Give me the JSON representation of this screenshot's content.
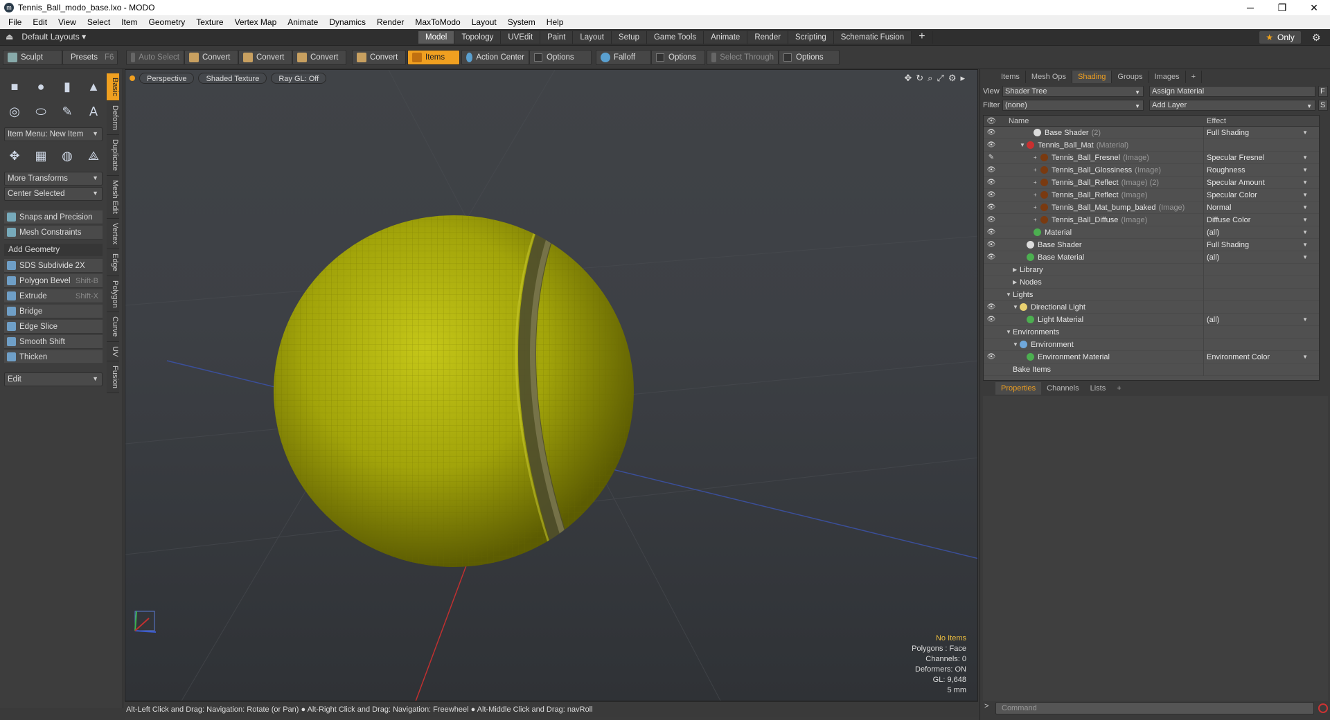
{
  "window": {
    "title": "Tennis_Ball_modo_base.lxo - MODO",
    "minimize": "─",
    "maximize": "❐",
    "close": "✕"
  },
  "menu": [
    "File",
    "Edit",
    "View",
    "Select",
    "Item",
    "Geometry",
    "Texture",
    "Vertex Map",
    "Animate",
    "Dynamics",
    "Render",
    "MaxToModo",
    "Layout",
    "System",
    "Help"
  ],
  "layoutbar": {
    "layout_label": "Default Layouts ▾",
    "tabs": [
      "Model",
      "Topology",
      "UVEdit",
      "Paint",
      "Layout",
      "Setup",
      "Game Tools",
      "Animate",
      "Render",
      "Scripting",
      "Schematic Fusion"
    ],
    "active_tab": "Model",
    "plus": "+",
    "only_label": "Only",
    "star": "★"
  },
  "toolbar": {
    "sculpt": "Sculpt",
    "presets": "Presets",
    "presets_key": "F6",
    "auto_select": "Auto Select",
    "convert1": "Convert",
    "convert2": "Convert",
    "convert3": "Convert",
    "convert4": "Convert",
    "items": "Items",
    "action_center": "Action Center",
    "options1": "Options",
    "falloff": "Falloff",
    "options2": "Options",
    "select_through": "Select Through",
    "options3": "Options"
  },
  "leftpanel": {
    "item_menu": "Item Menu: New Item",
    "more_transforms": "More Transforms",
    "center_selected": "Center Selected",
    "snaps": "Snaps and Precision",
    "mesh_constraints": "Mesh Constraints",
    "add_geometry": "Add Geometry",
    "tools": [
      {
        "label": "SDS Subdivide 2X",
        "key": ""
      },
      {
        "label": "Polygon Bevel",
        "key": "Shift-B"
      },
      {
        "label": "Extrude",
        "key": "Shift-X"
      },
      {
        "label": "Bridge",
        "key": ""
      },
      {
        "label": "Edge Slice",
        "key": ""
      },
      {
        "label": "Smooth Shift",
        "key": ""
      },
      {
        "label": "Thicken",
        "key": ""
      }
    ],
    "edit": "Edit",
    "vtabs": [
      "Basic",
      "Deform",
      "Duplicate",
      "Mesh Edit",
      "Vertex",
      "Edge",
      "Polygon",
      "Curve",
      "UV",
      "Fusion"
    ]
  },
  "viewport": {
    "view_mode": "Perspective",
    "shading": "Shaded Texture",
    "raygl": "Ray GL: Off",
    "info": {
      "selection": "No Items",
      "polygons": "Polygons : Face",
      "channels": "Channels: 0",
      "deformers": "Deformers: ON",
      "gl": "GL: 9,648",
      "scale": "5 mm"
    }
  },
  "statusbar": "Alt-Left Click and Drag: Navigation: Rotate (or Pan) ● Alt-Right Click and Drag: Navigation: Freewheel ● Alt-Middle Click and Drag: navRoll",
  "rightpanel": {
    "tabs": [
      "Items",
      "Mesh Ops",
      "Shading",
      "Groups",
      "Images",
      "+"
    ],
    "active_tab": "Shading",
    "view_label": "View",
    "view_value": "Shader Tree",
    "assign_material": "Assign Material",
    "f_btn": "F",
    "filter_label": "Filter",
    "filter_value": "(none)",
    "add_layer": "Add Layer",
    "s_btn": "S",
    "col_name": "Name",
    "col_effect": "Effect",
    "rows": [
      {
        "indent": 4,
        "exp": "",
        "ball": "#dcdcdc",
        "name": "Base Shader",
        "sub": "(2)",
        "effect": "Full Shading",
        "eye": "👁"
      },
      {
        "indent": 3,
        "exp": "▼",
        "ball": "#c83030",
        "name": "Tennis_Ball_Mat",
        "sub": "(Material)",
        "effect": "",
        "eye": "👁"
      },
      {
        "indent": 5,
        "exp": "+",
        "ball": "#7a3a10",
        "name": "Tennis_Ball_Fresnel",
        "sub": "(Image)",
        "effect": "Specular Fresnel",
        "eye": "✎"
      },
      {
        "indent": 5,
        "exp": "+",
        "ball": "#7a3a10",
        "name": "Tennis_Ball_Glossiness",
        "sub": "(Image)",
        "effect": "Roughness",
        "eye": "👁"
      },
      {
        "indent": 5,
        "exp": "+",
        "ball": "#7a3a10",
        "name": "Tennis_Ball_Reflect",
        "sub": "(Image) (2)",
        "effect": "Specular Amount",
        "eye": "👁"
      },
      {
        "indent": 5,
        "exp": "+",
        "ball": "#7a3a10",
        "name": "Tennis_Ball_Reflect",
        "sub": "(Image)",
        "effect": "Specular Color",
        "eye": "👁"
      },
      {
        "indent": 5,
        "exp": "+",
        "ball": "#7a3a10",
        "name": "Tennis_Ball_Mat_bump_baked",
        "sub": "(Image)",
        "effect": "Normal",
        "eye": "👁"
      },
      {
        "indent": 5,
        "exp": "+",
        "ball": "#7a3a10",
        "name": "Tennis_Ball_Diffuse",
        "sub": "(Image)",
        "effect": "Diffuse Color",
        "eye": "👁"
      },
      {
        "indent": 4,
        "exp": "",
        "ball": "#4caf50",
        "name": "Material",
        "sub": "",
        "effect": "(all)",
        "eye": "👁"
      },
      {
        "indent": 3,
        "exp": "",
        "ball": "#dcdcdc",
        "name": "Base Shader",
        "sub": "",
        "effect": "Full Shading",
        "eye": "👁"
      },
      {
        "indent": 3,
        "exp": "",
        "ball": "#4caf50",
        "name": "Base Material",
        "sub": "",
        "effect": "(all)",
        "eye": "👁"
      },
      {
        "indent": 2,
        "exp": "▶",
        "ball": "",
        "name": "Library",
        "sub": "",
        "effect": "",
        "eye": ""
      },
      {
        "indent": 2,
        "exp": "▶",
        "ball": "",
        "name": "Nodes",
        "sub": "",
        "effect": "",
        "eye": ""
      },
      {
        "indent": 1,
        "exp": "▼",
        "ball": "",
        "name": "Lights",
        "sub": "",
        "effect": "",
        "eye": ""
      },
      {
        "indent": 2,
        "exp": "▼",
        "ball": "#e8d070",
        "name": "Directional Light",
        "sub": "",
        "effect": "",
        "eye": "👁"
      },
      {
        "indent": 3,
        "exp": "",
        "ball": "#4caf50",
        "name": "Light Material",
        "sub": "",
        "effect": "(all)",
        "eye": "👁"
      },
      {
        "indent": 1,
        "exp": "▼",
        "ball": "",
        "name": "Environments",
        "sub": "",
        "effect": "",
        "eye": ""
      },
      {
        "indent": 2,
        "exp": "▼",
        "ball": "#6fa8dc",
        "name": "Environment",
        "sub": "",
        "effect": "",
        "eye": ""
      },
      {
        "indent": 3,
        "exp": "",
        "ball": "#4caf50",
        "name": "Environment Material",
        "sub": "",
        "effect": "Environment Color",
        "eye": "👁"
      },
      {
        "indent": 1,
        "exp": "",
        "ball": "",
        "name": "Bake Items",
        "sub": "",
        "effect": "",
        "eye": ""
      }
    ],
    "lower_tabs": [
      "Properties",
      "Channels",
      "Lists",
      "+"
    ],
    "lower_active": "Properties",
    "command_placeholder": "Command",
    "command_arrow": ">"
  },
  "colors": {
    "accent": "#f0a020",
    "ball": "#a8a800"
  }
}
